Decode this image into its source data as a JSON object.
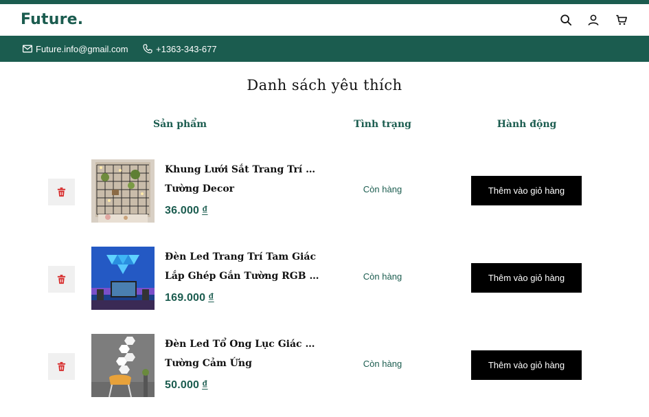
{
  "brand": {
    "logo": "Future.",
    "accent": "#1b5c4f"
  },
  "header_icons": [
    "search-icon",
    "user-icon",
    "cart-icon"
  ],
  "contact": {
    "email": "Future.info@gmail.com",
    "phone": "+1363-343-677"
  },
  "wishlist": {
    "title": "Danh sách yêu thích",
    "columns": {
      "product": "Sản phẩm",
      "status": "Tình trạng",
      "action": "Hành động"
    },
    "items": [
      {
        "name_line1": "Khung Lưới Sắt Trang Trí Treo",
        "name_line2": "Tường Decor",
        "price": "36.000",
        "currency": "₫",
        "status": "Còn hàng",
        "action": "Thêm vào giỏ hàng"
      },
      {
        "name_line1": "Đèn Led Trang Trí Tam Giác",
        "name_line2": "Lắp Ghép Gắn Tường RGB Cả...",
        "price": "169.000",
        "currency": "₫",
        "status": "Còn hàng",
        "action": "Thêm vào giỏ hàng"
      },
      {
        "name_line1": "Đèn Led Tổ Ong Lục Giác Gắn",
        "name_line2": "Tường Cảm Ứng",
        "price": "50.000",
        "currency": "₫",
        "status": "Còn hàng",
        "action": "Thêm vào giỏ hàng"
      }
    ]
  }
}
